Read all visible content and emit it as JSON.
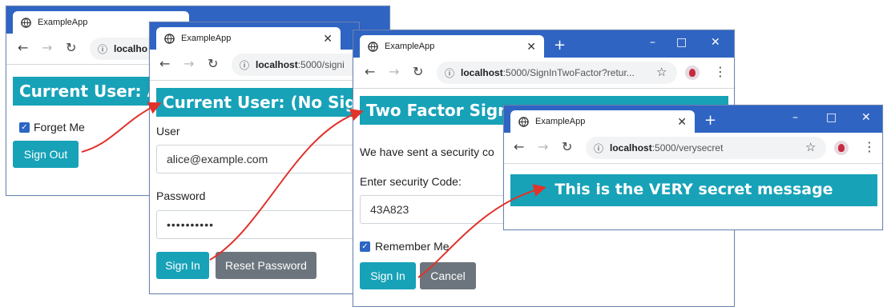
{
  "tab_title": "ExampleApp",
  "new_tab_label": "+",
  "window_controls": {
    "minimize": "–",
    "maximize": "□",
    "close": "✕"
  },
  "nav": {
    "back": "←",
    "forward": "→",
    "reload": "↻",
    "info": "ⓘ",
    "star": "☆",
    "menu": "⋮"
  },
  "tab_close": "✕",
  "windows": {
    "w1": {
      "url_host": "localho",
      "url_path": "",
      "banner": "Current User: Al",
      "checkbox_label": "Forget Me",
      "button": "Sign Out"
    },
    "w2": {
      "url_host": "localhost",
      "url_path": ":5000/signi",
      "banner": "Current User: (No Signe",
      "user_label": "User",
      "user_value": "alice@example.com",
      "password_label": "Password",
      "password_value": "••••••••••",
      "sign_in": "Sign In",
      "reset": "Reset Password"
    },
    "w3": {
      "url_host": "localhost",
      "url_path": ":5000/SignInTwoFactor?retur...",
      "banner": "Two Factor Sign",
      "message": "We have sent a security co",
      "code_label": "Enter security Code:",
      "code_value": "43A823",
      "remember_label": "Remember Me",
      "sign_in": "Sign In",
      "cancel": "Cancel"
    },
    "w4": {
      "url_host": "localhost",
      "url_path": ":5000/verysecret",
      "banner": "This is the VERY secret message"
    }
  },
  "colors": {
    "titlebar": "#2f64c2",
    "banner": "#17a2b8",
    "secondary_button": "#6c757d",
    "arrow": "#e0332b"
  }
}
